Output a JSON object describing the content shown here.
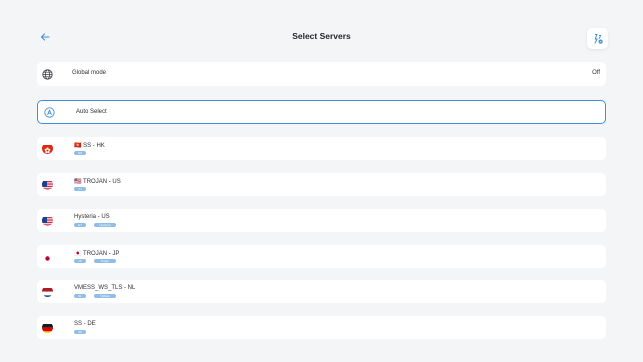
{
  "header": {
    "title": "Select Servers",
    "back_icon": "arrow-left-icon",
    "speed_icon": "speed-test-icon"
  },
  "global_mode": {
    "label": "Global mode",
    "value": "Off",
    "icon": "globe-icon"
  },
  "auto_select": {
    "label": "Auto Select",
    "icon": "auto-select-icon"
  },
  "servers": [
    {
      "name": "SS - HK",
      "flag_emoji": "🇭🇰",
      "flag": "hk",
      "tags": [
        "SS"
      ]
    },
    {
      "name": "TROJAN - US",
      "flag_emoji": "🇺🇸",
      "flag": "us",
      "tags": [
        "TJ"
      ]
    },
    {
      "name": "Hysteria - US",
      "flag_emoji": "",
      "flag": "us",
      "tags": [
        "HY",
        "Hysteria"
      ]
    },
    {
      "name": "TROJAN - JP",
      "flag_emoji": "🇯🇵",
      "flag": "jp",
      "tags": [
        "JP",
        "Trojan"
      ]
    },
    {
      "name": "VMESS_WS_TLS - NL",
      "flag_emoji": "",
      "flag": "nl",
      "tags": [
        "NL",
        "VMess"
      ]
    },
    {
      "name": "SS - DE",
      "flag_emoji": "",
      "flag": "de",
      "tags": [
        "SS"
      ]
    }
  ],
  "colors": {
    "accent": "#3f8fd8",
    "tag": "#8fbde6",
    "background": "#f4f5f7"
  }
}
